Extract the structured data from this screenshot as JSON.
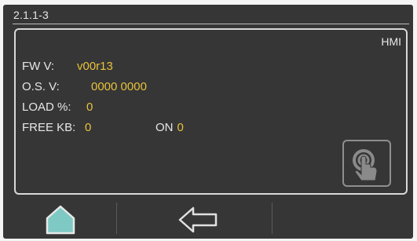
{
  "header": {
    "breadcrumb": "2.1.1-3"
  },
  "panel": {
    "badge": "HMI",
    "fw_version": {
      "label": "FW V:",
      "value": "v00r13"
    },
    "os_version": {
      "label": "O.S. V:",
      "value": "0000 0000"
    },
    "load": {
      "label": "LOAD %:",
      "value": "0"
    },
    "free_kb": {
      "label": "FREE KB:",
      "value": "0"
    },
    "on": {
      "label": "ON",
      "value": "0"
    }
  },
  "icons": {
    "touch": "touch-hand-icon",
    "home": "home-icon",
    "back": "arrow-left-icon"
  },
  "colors": {
    "screen_bg": "#363636",
    "value_accent": "#e8c23b",
    "text": "#e6e6e6"
  }
}
